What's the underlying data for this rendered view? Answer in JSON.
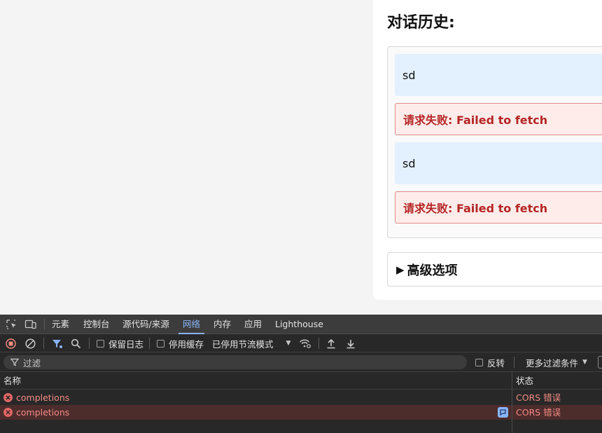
{
  "chat": {
    "history_title": "对话历史:",
    "messages": [
      {
        "role": "user",
        "text": "sd"
      },
      {
        "role": "error",
        "text": "请求失败: Failed to fetch"
      },
      {
        "role": "user",
        "text": "sd"
      },
      {
        "role": "error",
        "text": "请求失败: Failed to fetch"
      }
    ],
    "advanced_label": "高级选项",
    "advanced_marker": "▶"
  },
  "devtools": {
    "tabs": [
      {
        "label": "元素"
      },
      {
        "label": "控制台"
      },
      {
        "label": "源代码/来源"
      },
      {
        "label": "网络",
        "active": true
      },
      {
        "label": "内存"
      },
      {
        "label": "应用"
      },
      {
        "label": "Lighthouse"
      }
    ],
    "toolbar": {
      "preserve_log": "保留日志",
      "disable_cache": "停用缓存",
      "throttling": "已停用节流模式"
    },
    "filter": {
      "placeholder": "过滤",
      "invert": "反转",
      "more_filters": "更多过滤条件"
    },
    "table": {
      "columns": {
        "name": "名称",
        "status": "状态"
      },
      "rows": [
        {
          "name": "completions",
          "status": "CORS 错误"
        },
        {
          "name": "completions",
          "status": "CORS 错误"
        }
      ]
    },
    "colors": {
      "accent": "#8ab4f8",
      "error": "#f28b82",
      "selected_row": "#4d2c2c"
    }
  }
}
